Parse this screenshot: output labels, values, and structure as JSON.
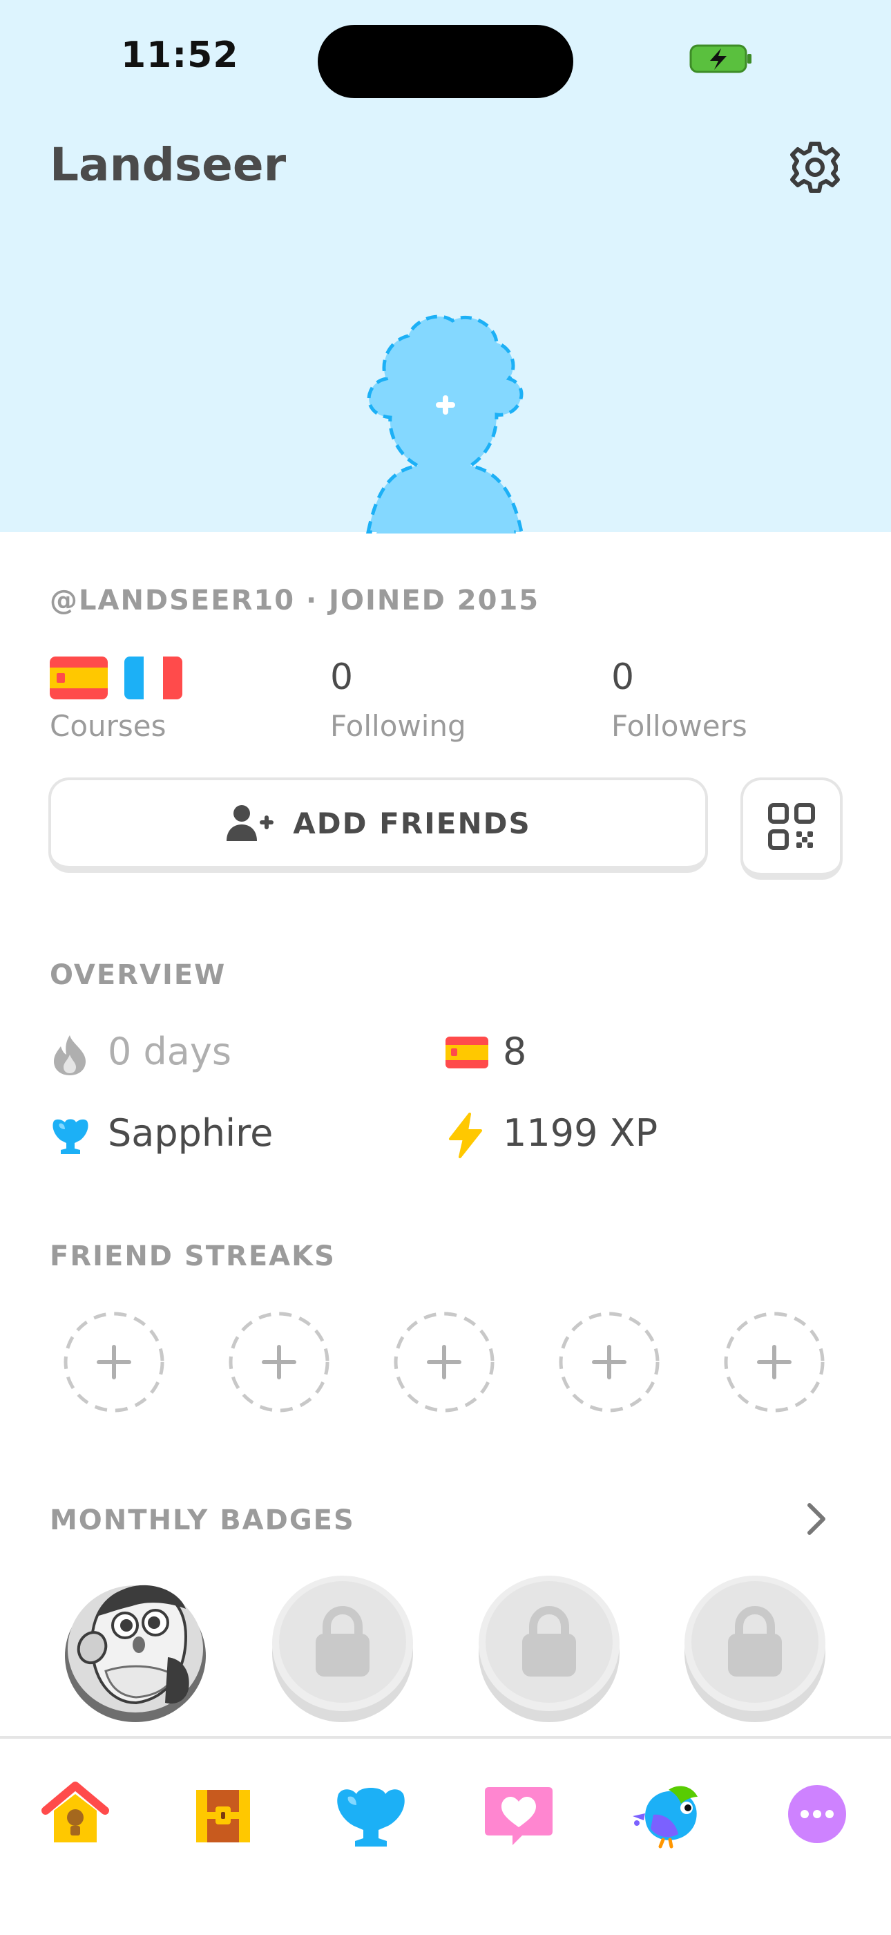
{
  "status_bar": {
    "time": "11:52"
  },
  "header": {
    "profile_name": "Landseer"
  },
  "profile": {
    "username_joined": "@LANDSEER10 · JOINED 2015",
    "courses_label": "Courses",
    "following_count": "0",
    "following_label": "Following",
    "followers_count": "0",
    "followers_label": "Followers",
    "add_friends_label": "ADD FRIENDS"
  },
  "overview": {
    "title": "OVERVIEW",
    "streak": "0 days",
    "course_count": "8",
    "league": "Sapphire",
    "xp": "1199 XP"
  },
  "friend_streaks": {
    "title": "FRIEND STREAKS"
  },
  "monthly_badges": {
    "title": "MONTHLY BADGES"
  },
  "colors": {
    "header_bg": "#ddf4fe",
    "avatar_blue": "#84d8ff",
    "text_dark": "#4b4b4b",
    "text_muted": "#9b9b9b",
    "border": "#e5e5e5"
  },
  "icons": [
    "battery-charging-icon",
    "gear-icon",
    "avatar-placeholder",
    "spain-flag-icon",
    "france-flag-icon",
    "add-person-icon",
    "qr-code-icon",
    "flame-icon",
    "sapphire-league-icon",
    "lightning-icon",
    "chevron-right-icon",
    "lock-icon",
    "home-icon",
    "chest-icon",
    "leaderboard-icon",
    "heart-message-icon",
    "bird-icon",
    "more-icon"
  ]
}
